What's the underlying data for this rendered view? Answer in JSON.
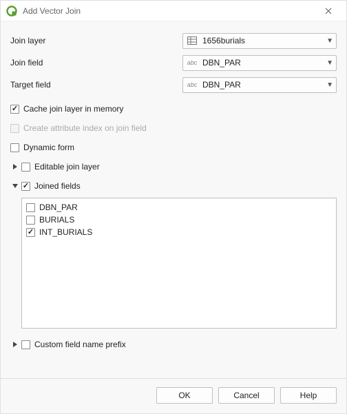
{
  "window": {
    "title": "Add Vector Join"
  },
  "form": {
    "join_layer": {
      "label": "Join layer",
      "value": "1656burials"
    },
    "join_field": {
      "label": "Join field",
      "value": "DBN_PAR",
      "type_prefix": "abc"
    },
    "target_field": {
      "label": "Target field",
      "value": "DBN_PAR",
      "type_prefix": "abc"
    }
  },
  "options": {
    "cache": {
      "label": "Cache join layer in memory",
      "checked": true
    },
    "index": {
      "label": "Create attribute index on join field",
      "checked": false,
      "enabled": false
    },
    "dynamic": {
      "label": "Dynamic form",
      "checked": false
    },
    "editable": {
      "label": "Editable join layer",
      "checked": false,
      "expanded": false
    },
    "joined_fields": {
      "label": "Joined fields",
      "checked": true,
      "expanded": true
    },
    "prefix": {
      "label": "Custom field name prefix",
      "checked": false,
      "expanded": false
    }
  },
  "joined_fields_list": [
    {
      "name": "DBN_PAR",
      "checked": false
    },
    {
      "name": "BURIALS",
      "checked": false
    },
    {
      "name": "INT_BURIALS",
      "checked": true
    }
  ],
  "buttons": {
    "ok": "OK",
    "cancel": "Cancel",
    "help": "Help"
  }
}
